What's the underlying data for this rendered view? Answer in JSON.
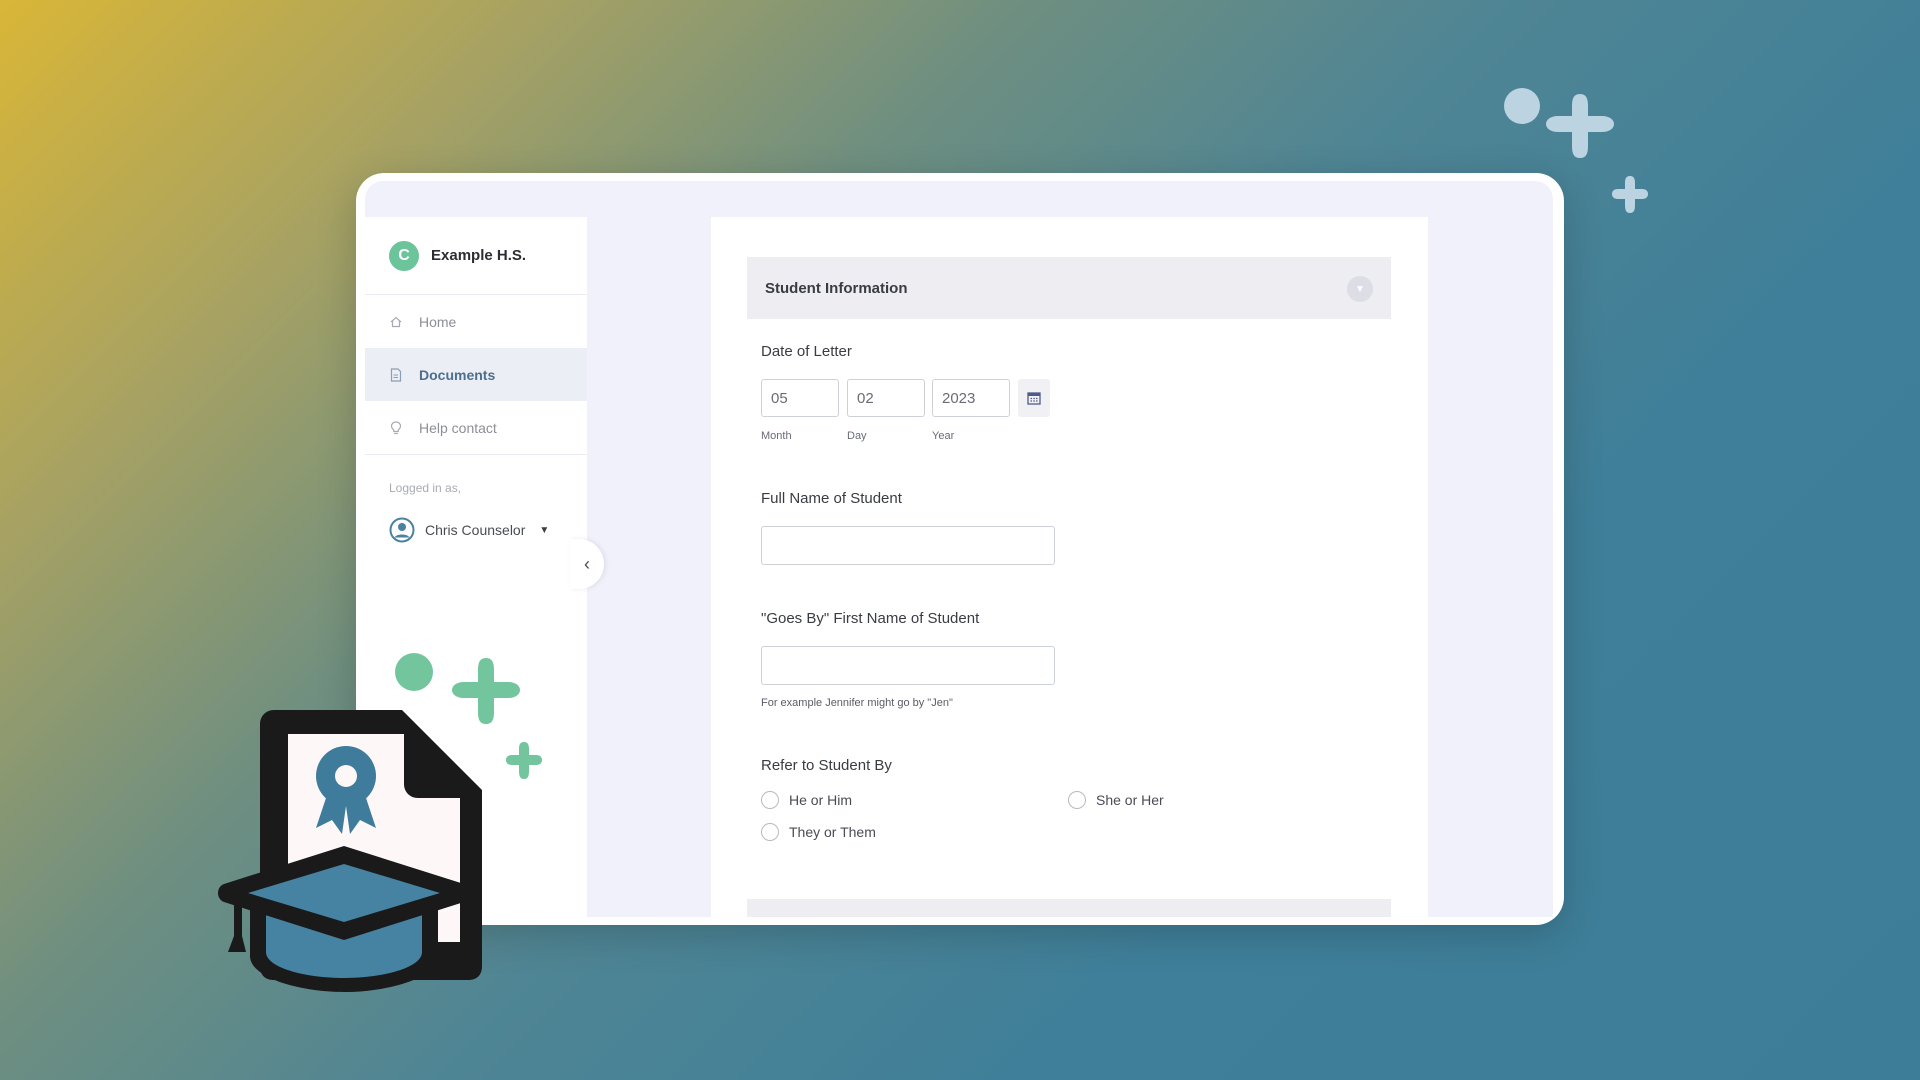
{
  "sidebar": {
    "brand_initial": "C",
    "brand_name": "Example H.S.",
    "items": [
      {
        "label": "Home",
        "icon": "home-icon"
      },
      {
        "label": "Documents",
        "icon": "document-icon"
      },
      {
        "label": "Help contact",
        "icon": "lightbulb-icon"
      }
    ],
    "logged_in_label": "Logged in as,",
    "user_name": "Chris Counselor"
  },
  "form": {
    "section_title": "Student Information",
    "date_label": "Date of Letter",
    "date": {
      "month": "05",
      "day": "02",
      "year": "2023",
      "month_label": "Month",
      "day_label": "Day",
      "year_label": "Year"
    },
    "full_name_label": "Full Name of Student",
    "full_name_value": "",
    "goes_by_label": "\"Goes By\" First Name of Student",
    "goes_by_value": "",
    "goes_by_hint": "For example Jennifer might go by \"Jen\"",
    "refer_label": "Refer to Student By",
    "refer_options": [
      "He or Him",
      "She or Her",
      "They or Them"
    ]
  },
  "colors": {
    "accent_green": "#6cc49b",
    "accent_blue": "#4a82a0",
    "nav_active": "#4d6f8c"
  }
}
